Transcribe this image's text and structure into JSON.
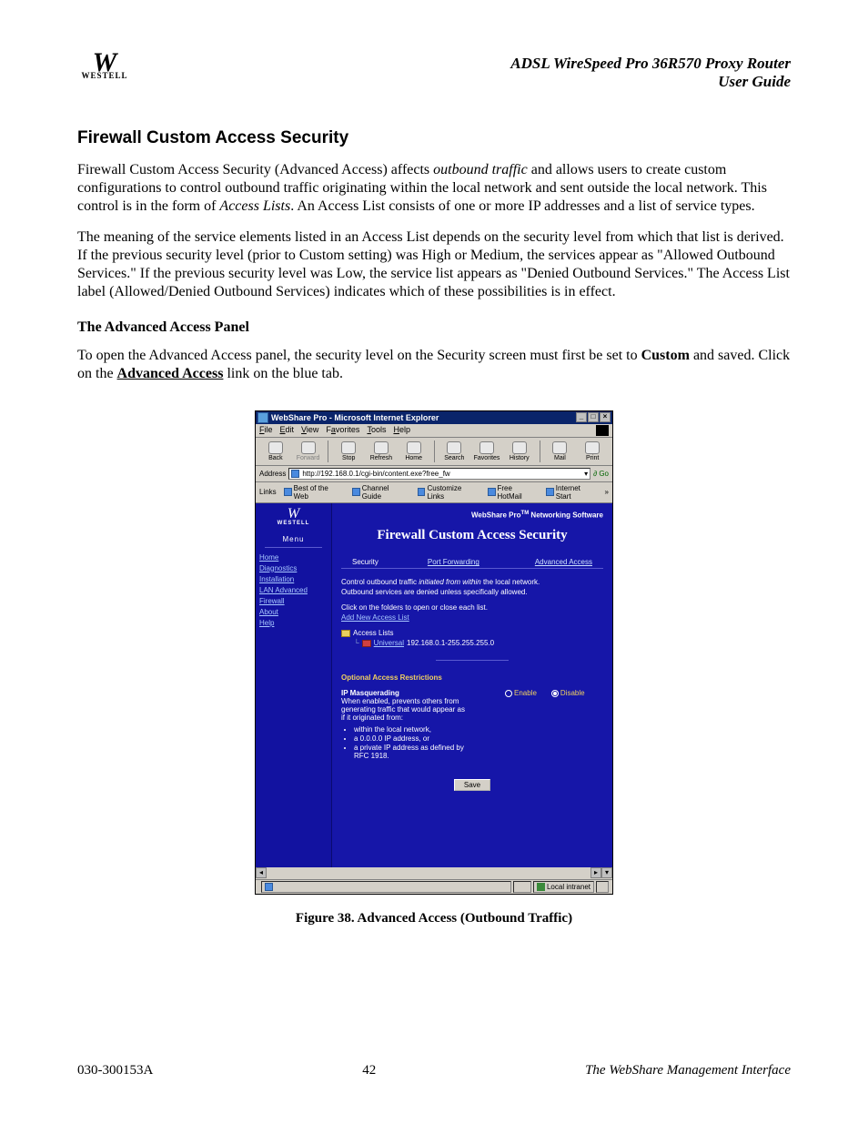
{
  "header": {
    "logo_text": "WESTELL",
    "product_line1": "ADSL WireSpeed Pro 36R570 Proxy Router",
    "product_line2": "User Guide"
  },
  "section": {
    "heading": "Firewall Custom Access Security",
    "para1_a": "Firewall Custom Access Security (Advanced Access) affects ",
    "para1_em": "outbound traffic",
    "para1_b": " and allows users to create custom configurations to control outbound traffic originating within the local network and sent outside the local network. This control is in the form of ",
    "para1_em2": "Access Lists",
    "para1_c": ". An Access List consists of one or more IP addresses and a list of service types.",
    "para2": "The meaning of the service elements listed in an Access List depends on the security level from which that list is derived.  If the previous security level (prior to Custom setting) was High or Medium, the services appear as \"Allowed Outbound Services.\"  If the previous security level was Low, the service list appears as \"Denied Outbound Services.\" The Access List label (Allowed/Denied Outbound Services) indicates which of these possibilities is in effect.",
    "subheading": "The Advanced Access Panel",
    "para3_a": "To open the Advanced Access panel, the security level on the Security screen must first be set to ",
    "para3_strong": "Custom",
    "para3_b": " and saved. Click on the ",
    "para3_link": "Advanced Access",
    "para3_c": " link on the blue tab."
  },
  "browser": {
    "title": "WebShare Pro - Microsoft Internet Explorer",
    "menu": {
      "file": "File",
      "edit": "Edit",
      "view": "View",
      "favorites": "Favorites",
      "tools": "Tools",
      "help": "Help"
    },
    "toolbar": {
      "back": "Back",
      "forward": "Forward",
      "stop": "Stop",
      "refresh": "Refresh",
      "home": "Home",
      "search": "Search",
      "favorites": "Favorites",
      "history": "History",
      "mail": "Mail",
      "print": "Print"
    },
    "address_label": "Address",
    "address_value": "http://192.168.0.1/cgi-bin/content.exe?free_fw",
    "go_label": "Go",
    "links_label": "Links",
    "quick_links": [
      "Best of the Web",
      "Channel Guide",
      "Customize Links",
      "Free HotMail",
      "Internet Start"
    ],
    "status_zone": "Local intranet"
  },
  "sidebar": {
    "logo_text": "WESTELL",
    "menu_title": "Menu",
    "items": [
      "Home",
      "Diagnostics",
      "Installation",
      "LAN Advanced",
      "Firewall",
      "About",
      "Help"
    ]
  },
  "panel": {
    "software_title": "WebShare Pro™ Networking Software",
    "heading": "Firewall Custom Access Security",
    "tabs": {
      "security": "Security",
      "port_forwarding": "Port Forwarding",
      "advanced_access": "Advanced Access"
    },
    "desc1_a": "Control outbound traffic ",
    "desc1_em": "initiated from within",
    "desc1_b": " the local network.",
    "desc2": "Outbound services are denied unless specifically allowed.",
    "desc3": "Click on the folders to open or close each list.",
    "add_link": "Add New Access List",
    "tree_root": "Access Lists",
    "tree_item_label": "Universal",
    "tree_item_range": "192.168.0.1-255.255.255.0",
    "opt_heading": "Optional Access Restrictions",
    "ipm_title": "IP Masquerading",
    "ipm_desc": "When enabled, prevents others from generating traffic that would appear as if it originated from:",
    "ipm_bullets": [
      "within the local network,",
      "a 0.0.0.0 IP address, or",
      "a private IP address as defined by RFC 1918."
    ],
    "enable": "Enable",
    "disable": "Disable",
    "save": "Save"
  },
  "figure_caption": "Figure 38. Advanced Access (Outbound Traffic)",
  "footer": {
    "left": "030-300153A",
    "center": "42",
    "right": "The WebShare Management Interface"
  }
}
